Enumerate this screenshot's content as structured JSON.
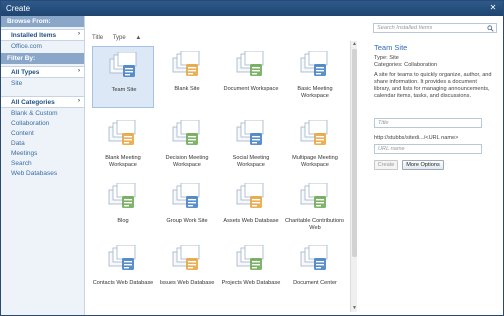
{
  "window": {
    "title": "Create"
  },
  "sidebar": {
    "browse_header": "Browse From:",
    "browse_items": [
      {
        "label": "Installed Items",
        "selected": true
      },
      {
        "label": "Office.com",
        "selected": false
      }
    ],
    "filter_header": "Filter By:",
    "type_items": [
      {
        "label": "All Types",
        "selected": true
      },
      {
        "label": "Site",
        "selected": false
      }
    ],
    "category_items": [
      {
        "label": "All Categories",
        "selected": true
      },
      {
        "label": "Blank & Custom"
      },
      {
        "label": "Collaboration"
      },
      {
        "label": "Content"
      },
      {
        "label": "Data"
      },
      {
        "label": "Meetings"
      },
      {
        "label": "Search"
      },
      {
        "label": "Web Databases"
      }
    ]
  },
  "columns": {
    "title": "Title",
    "type": "Type",
    "sort_glyph": "▲"
  },
  "gallery": [
    {
      "label": "Team Site",
      "icon": "team-site-icon",
      "selected": true
    },
    {
      "label": "Blank Site",
      "icon": "blank-site-icon"
    },
    {
      "label": "Document Workspace",
      "icon": "document-workspace-icon"
    },
    {
      "label": "Basic Meeting Workspace",
      "icon": "basic-meeting-icon"
    },
    {
      "label": "Blank Meeting Workspace",
      "icon": "blank-meeting-icon"
    },
    {
      "label": "Decision Meeting Workspace",
      "icon": "decision-meeting-icon"
    },
    {
      "label": "Social Meeting Workspace",
      "icon": "social-meeting-icon"
    },
    {
      "label": "Multipage Meeting Workspace",
      "icon": "multipage-meeting-icon"
    },
    {
      "label": "Blog",
      "icon": "blog-icon"
    },
    {
      "label": "Group Work Site",
      "icon": "group-work-icon"
    },
    {
      "label": "Assets Web Database",
      "icon": "assets-db-icon"
    },
    {
      "label": "Charitable Contributions Web",
      "icon": "charitable-icon"
    },
    {
      "label": "Contacts Web Database",
      "icon": "contacts-db-icon"
    },
    {
      "label": "Issues Web Database",
      "icon": "issues-db-icon"
    },
    {
      "label": "Projects Web Database",
      "icon": "projects-db-icon"
    },
    {
      "label": "Document Center",
      "icon": "document-center-icon"
    }
  ],
  "details": {
    "search_placeholder": "Search Installed Items",
    "title": "Team Site",
    "type_line": "Type: Site",
    "categories_line": "Categories: Collaboration",
    "description": "A site for teams to quickly organize, author, and share information. It provides a document library, and lists for managing announcements, calendar items, tasks, and discussions.",
    "title_placeholder": "Title",
    "url_prefix": "http://stubbs/sitedi.../<URL name>",
    "url_placeholder": "URL name",
    "create_label": "Create",
    "more_options_label": "More Options"
  },
  "colors": {
    "titlebar": "#1f4470",
    "accent": "#2e6db5",
    "selected_tile": "#dce8f6"
  }
}
